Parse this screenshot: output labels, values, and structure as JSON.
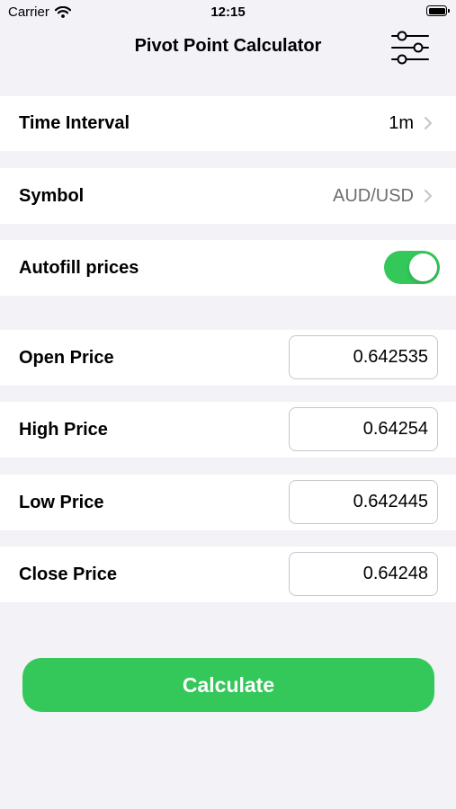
{
  "status_bar": {
    "carrier": "Carrier",
    "time": "12:15",
    "wifi_icon": "wifi-icon",
    "battery_icon": "battery-icon"
  },
  "nav": {
    "title": "Pivot Point Calculator",
    "settings_icon": "sliders-icon"
  },
  "settings": {
    "time_interval": {
      "label": "Time Interval",
      "value": "1m"
    },
    "symbol": {
      "label": "Symbol",
      "value": "AUD/USD"
    },
    "autofill": {
      "label": "Autofill prices",
      "on": true
    }
  },
  "prices": {
    "open": {
      "label": "Open Price",
      "value": "0.642535"
    },
    "high": {
      "label": "High Price",
      "value": "0.64254"
    },
    "low": {
      "label": "Low Price",
      "value": "0.642445"
    },
    "close": {
      "label": "Close Price",
      "value": "0.64248"
    }
  },
  "calculate_label": "Calculate",
  "colors": {
    "accent": "#34c759",
    "background": "#f2f2f7",
    "cell": "#ffffff",
    "secondary_text": "#6d6d72",
    "chevron": "#c4c4c7",
    "field_border": "#c7c7cc"
  }
}
